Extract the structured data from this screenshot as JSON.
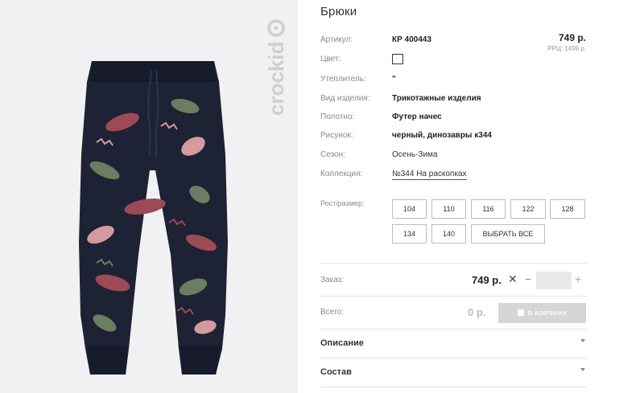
{
  "brand": {
    "logo_text": "crockid"
  },
  "product": {
    "title": "Брюки",
    "price": "749 р.",
    "rrp": "РРЦ: 1499 р."
  },
  "attributes": [
    {
      "label": "Артикул:",
      "value": "КР 400443",
      "style": "bold"
    },
    {
      "label": "Цвет:",
      "value": "",
      "style": "color-box"
    },
    {
      "label": "Утеплитель:",
      "value": "\"",
      "style": "bold"
    },
    {
      "label": "Вид изделия:",
      "value": "Трикотажные изделия",
      "style": "bold"
    },
    {
      "label": "Полотно:",
      "value": "Футер начес",
      "style": "bold"
    },
    {
      "label": "Рисунок:",
      "value": "черный, динозавры к344",
      "style": "bold"
    },
    {
      "label": "Сезон:",
      "value": "Осень-Зима",
      "style": "normal"
    },
    {
      "label": "Коллекция:",
      "value": "№344 На раскопках",
      "style": "link"
    }
  ],
  "sizes": {
    "label": "Рост/размер:",
    "options": [
      "104",
      "110",
      "116",
      "122",
      "128",
      "134",
      "140"
    ],
    "select_all": "ВЫБРАТЬ ВСЕ"
  },
  "order": {
    "label": "Заказ:",
    "price": "749 р.",
    "remove_symbol": "✕",
    "minus_symbol": "−",
    "plus_symbol": "+",
    "quantity": ""
  },
  "total": {
    "label": "Всего:",
    "value": "0 р.",
    "cart_button": "В КОРЗИНУ"
  },
  "sections": [
    {
      "title": "Описание"
    },
    {
      "title": "Состав"
    }
  ],
  "colors": {
    "pants_base": "#1d2234",
    "dino_red": "#9c4a55",
    "dino_green": "#6b7d62",
    "dino_pink": "#d49aa0",
    "cart_disabled": "#d6d6d6"
  }
}
